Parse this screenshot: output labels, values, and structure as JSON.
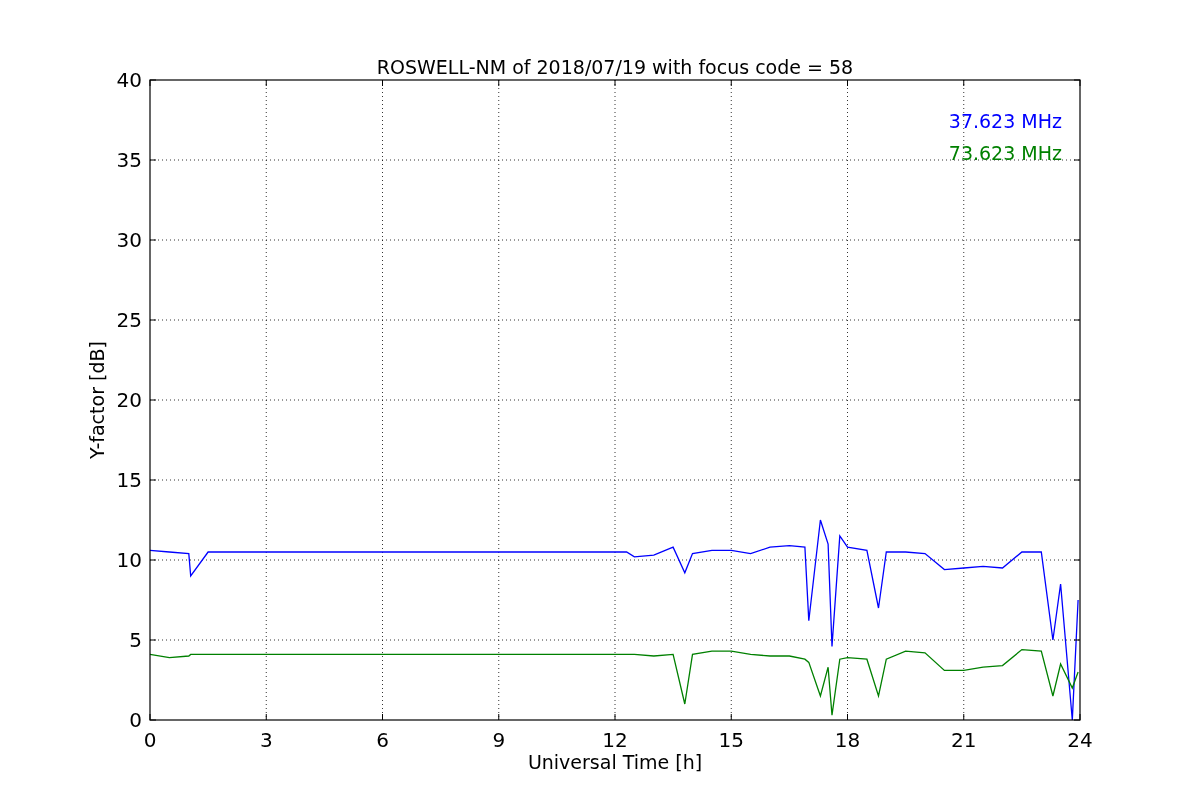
{
  "figure": {
    "chart_data": {
      "type": "line",
      "title": "ROSWELL-NM of 2018/07/19 with focus code = 58",
      "xlabel": "Universal Time [h]",
      "ylabel": "Y-factor [dB]",
      "x": [
        0,
        0.5,
        1,
        1.05,
        1.5,
        12.3,
        12.5,
        13,
        13.5,
        13.8,
        14,
        14.5,
        15,
        15.5,
        16,
        16.5,
        16.9,
        17,
        17.3,
        17.5,
        17.6,
        17.8,
        18,
        18.5,
        18.8,
        19,
        19.5,
        20,
        20.5,
        21,
        21.5,
        22,
        22.5,
        23,
        23.3,
        23.5,
        23.8,
        23.95
      ],
      "series": [
        {
          "name": "37.623 MHz",
          "color": "#0000ff",
          "values": [
            10.6,
            10.5,
            10.4,
            9.0,
            10.5,
            10.5,
            10.2,
            10.3,
            10.8,
            9.2,
            10.4,
            10.6,
            10.6,
            10.4,
            10.8,
            10.9,
            10.8,
            6.2,
            12.5,
            11.0,
            4.6,
            11.5,
            10.8,
            10.6,
            7.0,
            10.5,
            10.5,
            10.4,
            9.4,
            9.5,
            9.6,
            9.5,
            10.5,
            10.5,
            5.0,
            8.5,
            0,
            7.5
          ]
        },
        {
          "name": "73.623 MHz",
          "color": "#008000",
          "values": [
            4.1,
            3.9,
            4.0,
            4.1,
            4.1,
            4.1,
            4.1,
            4.0,
            4.1,
            1.0,
            4.1,
            4.3,
            4.3,
            4.1,
            4.0,
            4.0,
            3.8,
            3.6,
            1.5,
            3.3,
            0.3,
            3.8,
            3.9,
            3.8,
            1.5,
            3.8,
            4.3,
            4.2,
            3.1,
            3.1,
            3.3,
            3.4,
            4.4,
            4.3,
            1.5,
            3.5,
            2.0,
            3.0
          ]
        }
      ],
      "xlim": [
        0,
        24
      ],
      "ylim": [
        0,
        40
      ],
      "xticks": [
        0,
        3,
        6,
        9,
        12,
        15,
        18,
        21,
        24
      ],
      "yticks": [
        0,
        5,
        10,
        15,
        20,
        25,
        30,
        35,
        40
      ],
      "grid": true
    }
  }
}
